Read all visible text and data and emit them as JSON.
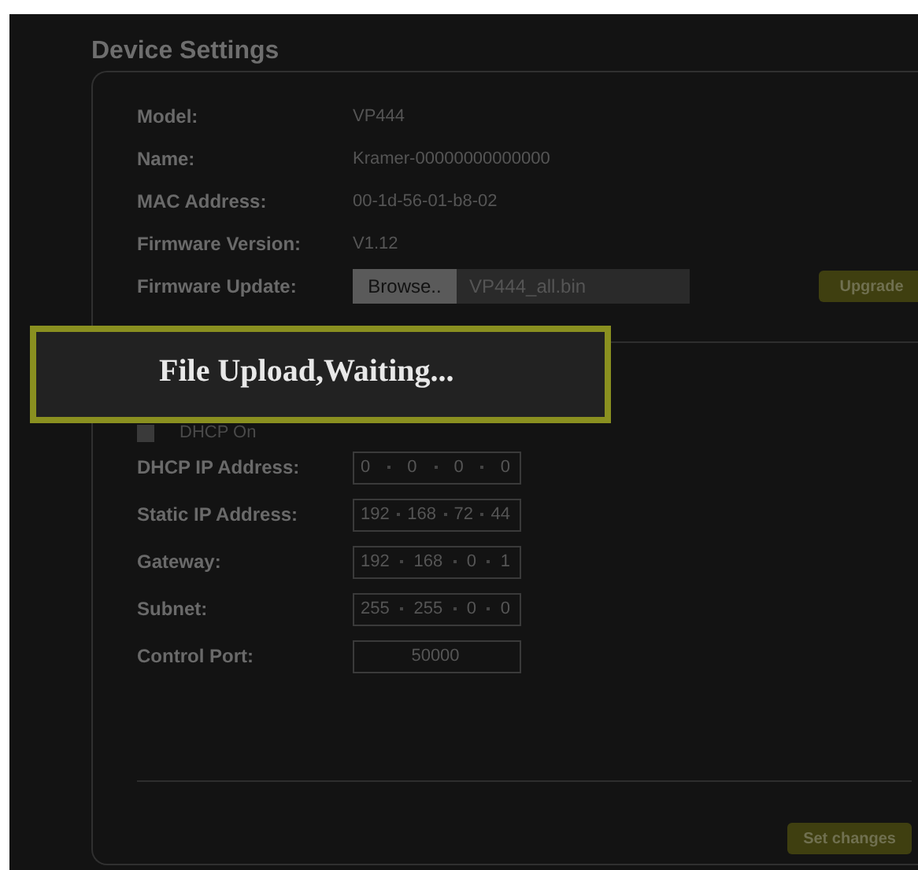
{
  "title": "Device Settings",
  "info": [
    {
      "label": "Model:",
      "value": "VP444"
    },
    {
      "label": "Name:",
      "value": "Kramer-00000000000000"
    },
    {
      "label": "MAC Address:",
      "value": "00-1d-56-01-b8-02"
    },
    {
      "label": "Firmware Version:",
      "value": "V1.12"
    }
  ],
  "firmware_update": {
    "label": "Firmware Update:",
    "browse": "Browse..",
    "file": "VP444_all.bin",
    "button": "Upgrade"
  },
  "overlay": {
    "message": "File Upload,Waiting..."
  },
  "dhcp": {
    "label": "DHCP On",
    "checked": false
  },
  "network": [
    {
      "label": "DHCP IP Address:",
      "octets": [
        "0",
        "0",
        "0",
        "0"
      ]
    },
    {
      "label": "Static IP Address:",
      "octets": [
        "192",
        "168",
        "72",
        "44"
      ]
    },
    {
      "label": "Gateway:",
      "octets": [
        "192",
        "168",
        "0",
        "1"
      ]
    },
    {
      "label": "Subnet:",
      "octets": [
        "255",
        "255",
        "0",
        "0"
      ]
    }
  ],
  "control_port": {
    "label": "Control Port:",
    "value": "50000"
  },
  "set_button": "Set changes"
}
